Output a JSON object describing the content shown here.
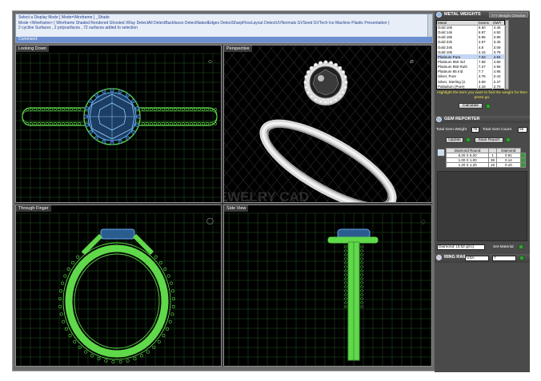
{
  "command_history": {
    "lines": [
      "Select a Display Mode [ Mode=Wireframe ] _Shade",
      "Mode <Wireframe> ( Wireframe  Shaded  Rendered  Ghosted  XRay  DetectAll  DetectBackfaces  DetectNakedEdges  DetectSharpFlowLayout  DetectUVNormals  GVSeed  GVTech  Ice  Machine  Plastic  Presentation )",
      "2 cycline Surfaces , 2 polysurfaces , 72 surfaces added to selection"
    ],
    "command_label": "Command:"
  },
  "viewports": {
    "top": "Looking Down",
    "perspective": "Perspective",
    "front": "Through Finger",
    "side": "Side View"
  },
  "watermark": "LEARN JEWELRY CAD",
  "metal_weights": {
    "title": "METAL WEIGHTS",
    "tab": "??? Weight Checker",
    "columns": [
      "Metal",
      "Grams",
      "DWT"
    ],
    "rows": [
      [
        "Gold 10k",
        "6.50",
        "4.45"
      ],
      [
        "Gold 14k",
        "6.97",
        "4.50"
      ],
      [
        "Gold 18k",
        "5.96",
        "3.85"
      ],
      [
        "Gold 22k",
        "4.97",
        "3.45"
      ],
      [
        "Gold 24k",
        "4.8",
        "3.09"
      ],
      [
        "Gold 10k",
        "4.15",
        "3.79"
      ],
      [
        "Platinum Pure",
        "7.63",
        "4.94"
      ],
      [
        "Platinum 950 Irid",
        "7.58",
        "4.80"
      ],
      [
        "Platinum 950 Ruth",
        "7.27",
        "4.96"
      ],
      [
        "Platinum 85 Irid",
        "7.7",
        "4.95"
      ],
      [
        "Silver, Pure",
        "3.76",
        "2.42"
      ],
      [
        "Silver, Sterling (2.",
        "3.69",
        "2.37"
      ],
      [
        "Palladium (Pure)",
        "4.18",
        "2.70"
      ]
    ],
    "selected_row": 6,
    "hint": "Highlight the item you want to find the weight for then press go.",
    "calculate_label": "Calculate"
  },
  "gem_reporter": {
    "title": "GEM REPORTER",
    "total_weight_label": "Total Gem Weight",
    "total_weight_value": "75",
    "total_count_label": "Total Gem Count",
    "total_count_value": "56",
    "update_label": "Update",
    "save_report_label": "Save Report",
    "columns": [
      "Diamond Round",
      "",
      "Diamond"
    ],
    "rows": [
      [
        "6.20 X 6.20",
        "1",
        "0.91"
      ],
      [
        "1.00 X 1.00",
        "38",
        "0.14"
      ],
      [
        "1.20 X 1.20",
        "16",
        "0.10"
      ]
    ],
    "material_select": "Diamond: (3.52 g/cc)",
    "set_material_label": "Set Material"
  },
  "ring_size": {
    "title": "RING RAIL",
    "country": "USA",
    "size": "7"
  },
  "colors": {
    "wire_green": "#5fd94a",
    "wire_blue": "#5fa8f0",
    "grid": "#1f5a1f",
    "command_line": "#6c8fd0"
  }
}
